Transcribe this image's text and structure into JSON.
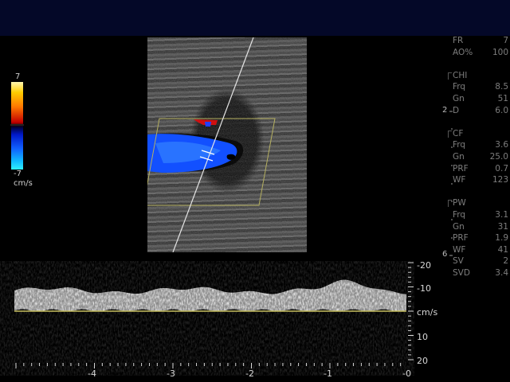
{
  "color_scale": {
    "top": "7",
    "bottom": "-7",
    "unit": "cm/s"
  },
  "params": {
    "general": [
      {
        "label": "FR",
        "value": "7"
      },
      {
        "label": "AO%",
        "value": "100"
      }
    ],
    "sections": [
      {
        "title": "CHI",
        "rows": [
          {
            "label": "Frq",
            "value": "8.5"
          },
          {
            "label": "Gn",
            "value": "51"
          },
          {
            "label": "D",
            "value": "6.0"
          }
        ]
      },
      {
        "title": "CF",
        "rows": [
          {
            "label": "Frq",
            "value": "3.6"
          },
          {
            "label": "Gn",
            "value": "25.0"
          },
          {
            "label": "PRF",
            "value": "0.7"
          },
          {
            "label": "WF",
            "value": "123"
          }
        ]
      },
      {
        "title": "PW",
        "rows": [
          {
            "label": "Frq",
            "value": "3.1"
          },
          {
            "label": "Gn",
            "value": "31"
          },
          {
            "label": "PRF",
            "value": "1.9"
          },
          {
            "label": "WF",
            "value": "41"
          },
          {
            "label": "SV",
            "value": "2"
          },
          {
            "label": "SVD",
            "value": "3.4"
          }
        ]
      }
    ]
  },
  "depth_markers": {
    "upper": "2",
    "lower": "6"
  },
  "doppler": {
    "velocity_labels": [
      "-20",
      "-10",
      "cm/s",
      "10",
      "20"
    ],
    "time_labels": [
      "-4",
      "-3",
      "-2",
      "-1",
      "-0"
    ]
  },
  "colors": {
    "baseline": "#c8c060",
    "roi_box": "#b5b060",
    "flow_blue": "#1250ff",
    "flow_red": "#d01010"
  }
}
